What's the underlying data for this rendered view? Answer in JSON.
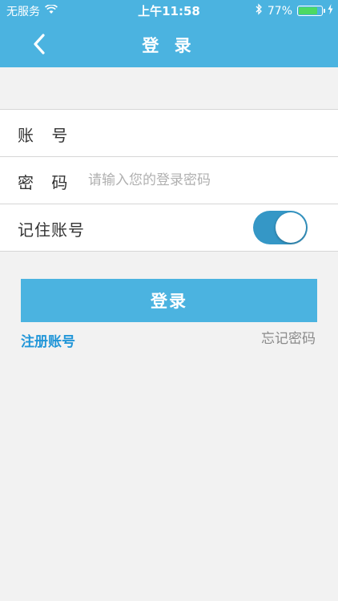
{
  "status_bar": {
    "carrier": "无服务",
    "time": "上午11:58",
    "battery_percent": "77%",
    "battery_level": 0.77,
    "icons": [
      "wifi-icon",
      "bluetooth-icon",
      "battery-icon",
      "charging-icon"
    ]
  },
  "nav": {
    "title": "登 录",
    "back_icon": "chevron-left-icon"
  },
  "form": {
    "account": {
      "label": "账 号",
      "value": "",
      "placeholder": ""
    },
    "password": {
      "label": "密 码",
      "value": "",
      "placeholder": "请输入您的登录密码"
    },
    "remember": {
      "label": "记住账号",
      "on": true
    }
  },
  "actions": {
    "login_label": "登录",
    "register_label": "注册账号",
    "forgot_label": "忘记密码"
  },
  "colors": {
    "accent": "#4bb3e0",
    "toggle_on": "#3597c6",
    "link": "#2196d8",
    "background": "#f2f2f2"
  }
}
